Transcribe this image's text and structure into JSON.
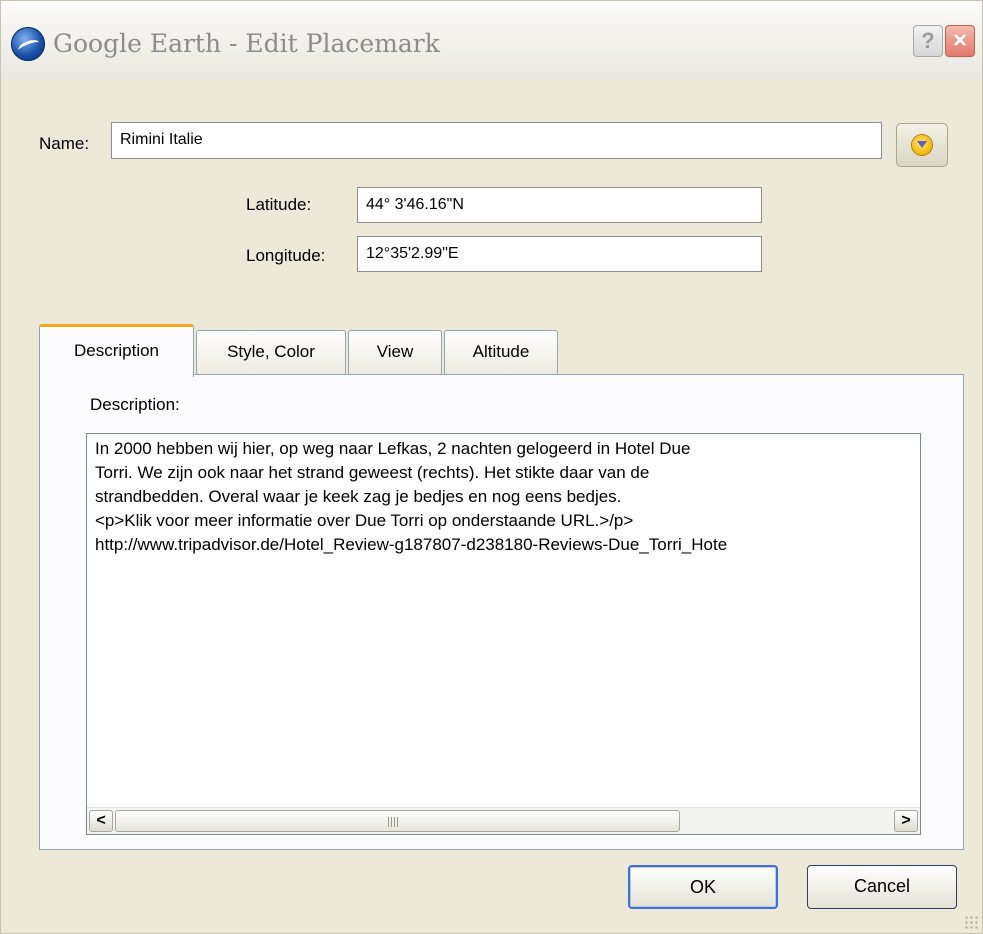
{
  "window": {
    "title": "Google Earth - Edit Placemark",
    "help_glyph": "?",
    "close_glyph": "×",
    "icons": {
      "app": "google-earth-icon",
      "placemark": "placemark-pin-icon"
    }
  },
  "form": {
    "name_label": "Name:",
    "name_value": "Rimini Italie",
    "latitude_label": "Latitude:",
    "latitude_value": "44° 3'46.16\"N",
    "longitude_label": "Longitude:",
    "longitude_value": "12°35'2.99\"E"
  },
  "tabs": [
    {
      "label": "Description",
      "active": true
    },
    {
      "label": "Style, Color",
      "active": false
    },
    {
      "label": "View",
      "active": false
    },
    {
      "label": "Altitude",
      "active": false
    }
  ],
  "description": {
    "label": "Description:",
    "lines": [
      "In 2000 hebben wij hier, op weg naar Lefkas, 2 nachten gelogeerd in Hotel Due",
      "Torri. We zijn ook naar het strand geweest (rechts). Het stikte daar van de",
      "strandbedden. Overal waar je keek zag je bedjes en nog eens bedjes.",
      "<p>Klik voor meer informatie over Due Torri op onderstaande URL.>/p>",
      "http://www.tripadvisor.de/Hotel_Review-g187807-d238180-Reviews-Due_Torri_Hote"
    ],
    "scroll_left": "<",
    "scroll_right": ">"
  },
  "buttons": {
    "ok": "OK",
    "cancel": "Cancel"
  },
  "colors": {
    "dialog_bg": "#ece9d8",
    "active_tab_accent": "#f3a91c",
    "default_button_border": "#3f6fcf",
    "close_button": "#e2796a"
  }
}
